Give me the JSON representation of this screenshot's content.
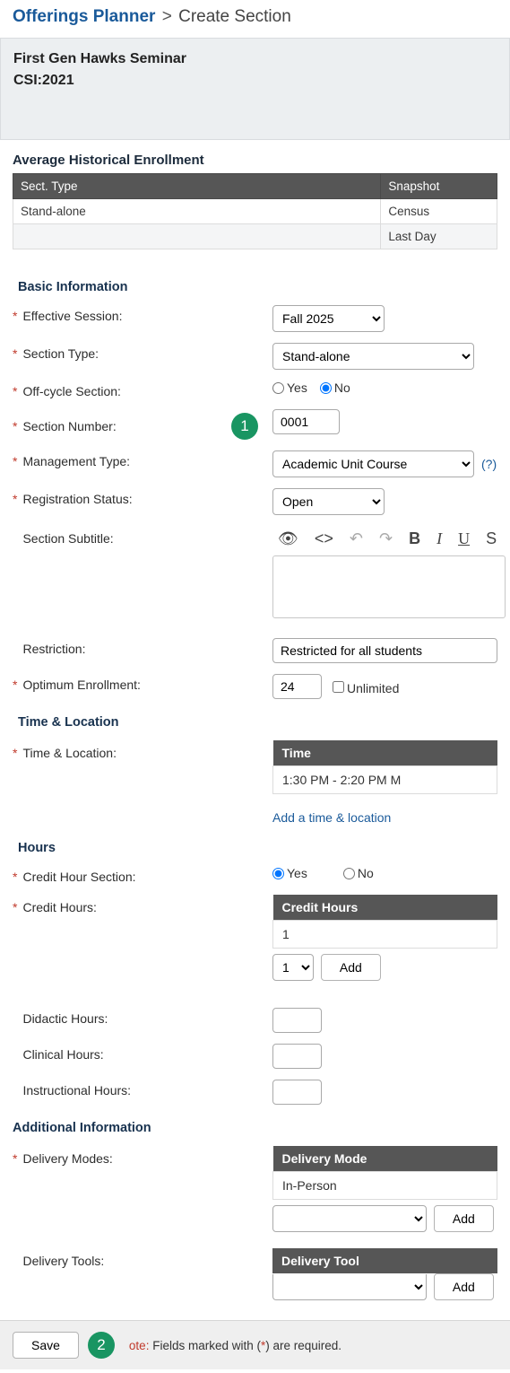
{
  "breadcrumb": {
    "root": "Offerings Planner",
    "current": "Create Section"
  },
  "course": {
    "title": "First Gen Hawks Seminar",
    "code": "CSI:2021"
  },
  "enrollment": {
    "heading": "Average Historical Enrollment",
    "columns": {
      "type": "Sect. Type",
      "snapshot": "Snapshot"
    },
    "rows": [
      {
        "type": "Stand-alone",
        "snapshot": "Census"
      },
      {
        "type": "",
        "snapshot": "Last Day"
      }
    ]
  },
  "sections": {
    "basic": "Basic Information",
    "timeloc": "Time & Location",
    "hours": "Hours",
    "additional": "Additional Information"
  },
  "labels": {
    "effectiveSession": "Effective Session:",
    "sectionType": "Section Type:",
    "offCycle": "Off-cycle Section:",
    "sectionNumber": "Section Number:",
    "mgmtType": "Management Type:",
    "regStatus": "Registration Status:",
    "subtitle": "Section Subtitle:",
    "restriction": "Restriction:",
    "optEnroll": "Optimum Enrollment:",
    "timeLocation": "Time & Location:",
    "creditHourSection": "Credit Hour Section:",
    "creditHours": "Credit Hours:",
    "didactic": "Didactic Hours:",
    "clinical": "Clinical Hours:",
    "instructional": "Instructional Hours:",
    "deliveryModes": "Delivery Modes:",
    "deliveryTools": "Delivery Tools:"
  },
  "values": {
    "effectiveSession": "Fall 2025",
    "sectionType": "Stand-alone",
    "offCycle": "No",
    "yes": "Yes",
    "no": "No",
    "sectionNumber": "0001",
    "mgmtType": "Academic Unit Course",
    "regStatus": "Open",
    "restriction": "Restricted for all students",
    "optEnroll": "24",
    "unlimited": "Unlimited",
    "timeHeader": "Time",
    "timeValue": "1:30 PM - 2:20 PM M",
    "addTimeLoc": "Add a time & location",
    "creditHourSection": "Yes",
    "creditHoursHeader": "Credit Hours",
    "creditHoursValue": "1",
    "creditHoursSel": "1",
    "add": "Add",
    "deliveryModeHeader": "Delivery Mode",
    "deliveryModeValue": "In-Person",
    "deliveryToolHeader": "Delivery Tool",
    "help": "(?)"
  },
  "markers": {
    "one": "1",
    "two": "2"
  },
  "footer": {
    "save": "Save",
    "noteLabel": "ote:",
    "noteText": " Fields marked with (",
    "noteStar": "*",
    "noteText2": ") are required."
  }
}
